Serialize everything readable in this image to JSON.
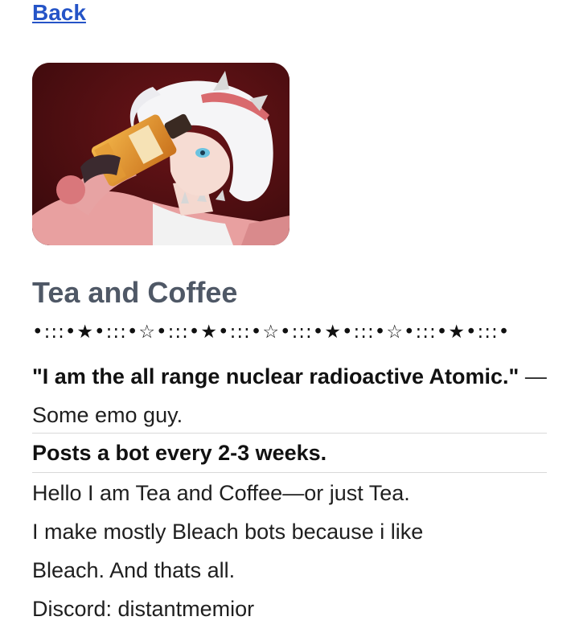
{
  "nav": {
    "back_label": "Back"
  },
  "profile": {
    "avatar_icon": "profile-avatar-illustration",
    "name": "Tea and Coffee",
    "stars_divider": "•:::•★•:::•☆•:::•★•:::•☆•:::•★•:::•☆•:::•★•:::•",
    "quote_bold": "\"I am the all range nuclear radioactive Atomic.\"",
    "quote_attribution": " — Some emo guy.",
    "schedule": "Posts a bot every 2-3 weeks.",
    "bio_lines": [
      "Hello I am Tea and Coffee—or just Tea.",
      "I make mostly Bleach bots because i like",
      "Bleach. And thats all.",
      "Discord: distantmemior"
    ]
  },
  "colors": {
    "link": "#2554c7",
    "name": "#4f5866",
    "divider": "#d9d9d9"
  }
}
